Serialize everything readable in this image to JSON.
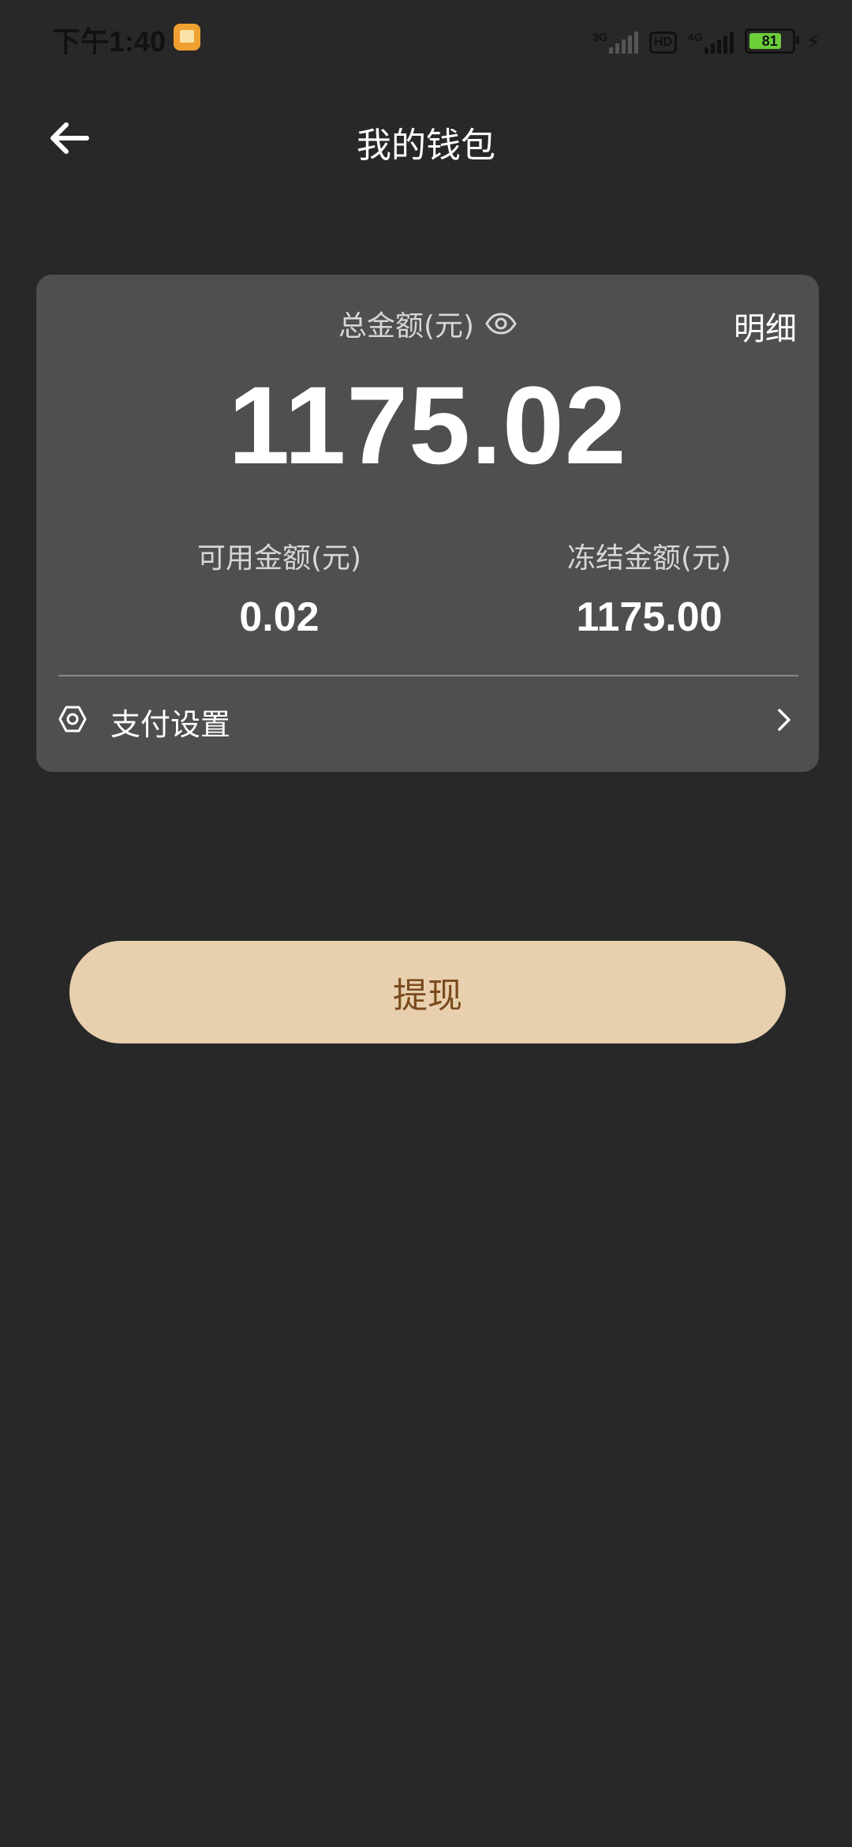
{
  "status_bar": {
    "time": "下午1:40",
    "network_1": "3G",
    "hd": "HD",
    "network_2": "4G",
    "battery_level": "81"
  },
  "header": {
    "title": "我的钱包"
  },
  "wallet": {
    "total_label": "总金额(元)",
    "detail_label": "明细",
    "total_amount": "1175.02",
    "available_label": "可用金额(元)",
    "available_amount": "0.02",
    "frozen_label": "冻结金额(元)",
    "frozen_amount": "1175.00",
    "pay_settings_label": "支付设置"
  },
  "actions": {
    "withdraw_label": "提现"
  },
  "colors": {
    "background": "#282828",
    "card": "#4f4f4f",
    "button": "#e8d0ae",
    "button_text": "#7a4a1c"
  }
}
